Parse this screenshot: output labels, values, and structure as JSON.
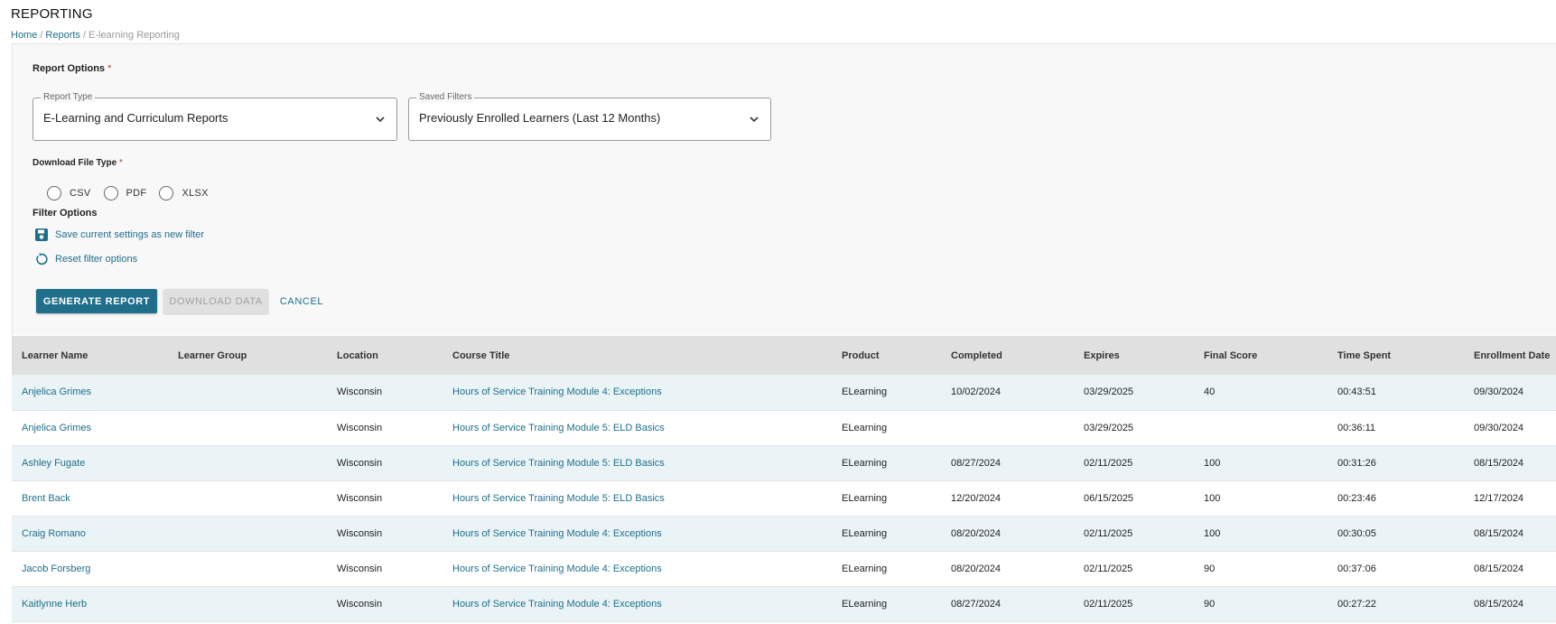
{
  "page": {
    "title": "REPORTING"
  },
  "breadcrumb": {
    "items": [
      "Home",
      "Reports"
    ],
    "current": "E-learning Reporting",
    "separator": "/"
  },
  "report_options": {
    "label": "Report Options",
    "required_mark": "*",
    "report_type": {
      "legend": "Report Type",
      "value": "E-Learning and Curriculum Reports"
    },
    "saved_filters": {
      "legend": "Saved Filters",
      "value": "Previously Enrolled Learners (Last 12 Months)"
    }
  },
  "download": {
    "label": "Download File Type",
    "required_mark": "*",
    "options": [
      "CSV",
      "PDF",
      "XLSX"
    ]
  },
  "filter_options": {
    "label": "Filter Options",
    "save_link": "Save current settings as new filter",
    "reset_link": "Reset filter options"
  },
  "buttons": {
    "generate": "GENERATE REPORT",
    "download": "DOWNLOAD DATA",
    "cancel": "CANCEL"
  },
  "table": {
    "columns": [
      "Learner Name",
      "Learner Group",
      "Location",
      "Course Title",
      "Product",
      "Completed",
      "Expires",
      "Final Score",
      "Time Spent",
      "Enrollment Date"
    ],
    "rows": [
      [
        "Anjelica Grimes",
        "",
        "Wisconsin",
        "Hours of Service Training Module 4: Exceptions",
        "ELearning",
        "10/02/2024",
        "03/29/2025",
        "40",
        "00:43:51",
        "09/30/2024"
      ],
      [
        "Anjelica Grimes",
        "",
        "Wisconsin",
        "Hours of Service Training Module 5: ELD Basics",
        "ELearning",
        "",
        "03/29/2025",
        "",
        "00:36:11",
        "09/30/2024"
      ],
      [
        "Ashley Fugate",
        "",
        "Wisconsin",
        "Hours of Service Training Module 5: ELD Basics",
        "ELearning",
        "08/27/2024",
        "02/11/2025",
        "100",
        "00:31:26",
        "08/15/2024"
      ],
      [
        "Brent Back",
        "",
        "Wisconsin",
        "Hours of Service Training Module 5: ELD Basics",
        "ELearning",
        "12/20/2024",
        "06/15/2025",
        "100",
        "00:23:46",
        "12/17/2024"
      ],
      [
        "Craig Romano",
        "",
        "Wisconsin",
        "Hours of Service Training Module 4: Exceptions",
        "ELearning",
        "08/20/2024",
        "02/11/2025",
        "100",
        "00:30:05",
        "08/15/2024"
      ],
      [
        "Jacob Forsberg",
        "",
        "Wisconsin",
        "Hours of Service Training Module 4: Exceptions",
        "ELearning",
        "08/20/2024",
        "02/11/2025",
        "90",
        "00:37:06",
        "08/15/2024"
      ],
      [
        "Kaitlynne Herb",
        "",
        "Wisconsin",
        "Hours of Service Training Module 4: Exceptions",
        "ELearning",
        "08/27/2024",
        "02/11/2025",
        "90",
        "00:27:22",
        "08/15/2024"
      ]
    ]
  },
  "colors": {
    "accent": "#1f6f8b",
    "row_alt": "#eaf3f6",
    "header_bg": "#e0e0e0",
    "required": "#c0392b"
  },
  "icons": {
    "chevron": "chevron-down-icon",
    "save": "floppy-disk-icon",
    "reset": "reset-icon"
  }
}
